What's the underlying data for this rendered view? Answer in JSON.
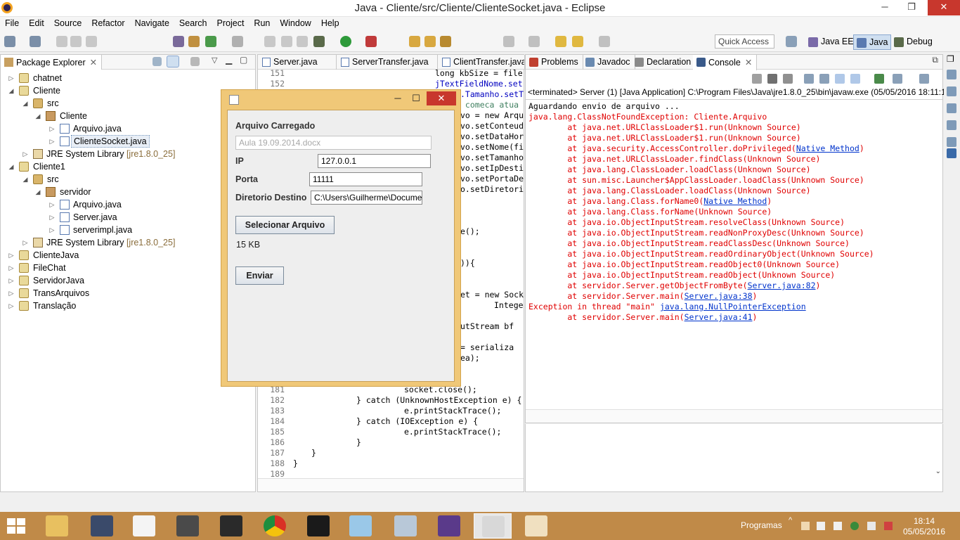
{
  "window": {
    "title": "Java - Cliente/src/Cliente/ClienteSocket.java - Eclipse"
  },
  "menu": [
    "File",
    "Edit",
    "Source",
    "Refactor",
    "Navigate",
    "Search",
    "Project",
    "Run",
    "Window",
    "Help"
  ],
  "toolbar": {
    "quick_access": "Quick Access",
    "perspectives": [
      "Java EE",
      "Java",
      "Debug"
    ]
  },
  "package_explorer": {
    "title": "Package Explorer",
    "rows": [
      {
        "label": "chatnet",
        "version": ""
      },
      {
        "label": "Cliente",
        "version": ""
      },
      {
        "label": "src",
        "version": ""
      },
      {
        "label": "Cliente",
        "version": ""
      },
      {
        "label": "Arquivo.java",
        "version": ""
      },
      {
        "label": "ClienteSocket.java",
        "version": ""
      },
      {
        "label": "JRE System Library",
        "version": "[jre1.8.0_25]"
      },
      {
        "label": "Cliente1",
        "version": ""
      },
      {
        "label": "src",
        "version": ""
      },
      {
        "label": "servidor",
        "version": ""
      },
      {
        "label": "Arquivo.java",
        "version": ""
      },
      {
        "label": "Server.java",
        "version": ""
      },
      {
        "label": "serverimpl.java",
        "version": ""
      },
      {
        "label": "JRE System Library",
        "version": "[jre1.8.0_25]"
      },
      {
        "label": "ClienteJava",
        "version": ""
      },
      {
        "label": "FileChat",
        "version": ""
      },
      {
        "label": "ServidorJava",
        "version": ""
      },
      {
        "label": "TransArquivos",
        "version": ""
      },
      {
        "label": "Translação",
        "version": ""
      }
    ]
  },
  "editor": {
    "tabs": [
      "Server.java",
      "ServerTransfer.java",
      "ClientTransfer.java"
    ],
    "lines": [
      {
        "n": "151",
        "text": "long kbSize = file"
      },
      {
        "n": "152",
        "text": "jTextFieldNome.set"
      },
      {
        "n": "",
        "text": ".Tamanho.setT"
      },
      {
        "n": "",
        "text": " comeca atua"
      },
      {
        "n": "",
        "text": "vo = new Arqu"
      },
      {
        "n": "",
        "text": "vo.setConteud"
      },
      {
        "n": "",
        "text": "vo.setDataHor"
      },
      {
        "n": "",
        "text": "vo.setNome(fi"
      },
      {
        "n": "",
        "text": "vo.setTamanho"
      },
      {
        "n": "",
        "text": "vo.setIpDesti"
      },
      {
        "n": "",
        "text": "vo.setPortaDe"
      },
      {
        "n": "",
        "text": "o.setDiretori"
      },
      {
        "n": "",
        "text": "e();"
      },
      {
        "n": "",
        "text": ")){"
      },
      {
        "n": "",
        "text": "et = new Sock"
      },
      {
        "n": "",
        "text": "Intege"
      },
      {
        "n": "",
        "text": "utStream bf"
      },
      {
        "n": "",
        "text": "= serializa"
      },
      {
        "n": "",
        "text": "ea);"
      },
      {
        "n": "181",
        "text": "socket.close();"
      },
      {
        "n": "182",
        "text": "} catch (UnknownHostException e) {"
      },
      {
        "n": "183",
        "text": "e.printStackTrace();"
      },
      {
        "n": "184",
        "text": "} catch (IOException e) {"
      },
      {
        "n": "185",
        "text": "e.printStackTrace();"
      },
      {
        "n": "186",
        "text": "}"
      },
      {
        "n": "187",
        "text": "}"
      },
      {
        "n": "188",
        "text": "}"
      },
      {
        "n": "189",
        "text": ""
      }
    ]
  },
  "console": {
    "tabs": [
      "Problems",
      "Javadoc",
      "Declaration",
      "Console"
    ],
    "terminated": "<terminated> Server (1) [Java Application] C:\\Program Files\\Java\\jre1.8.0_25\\bin\\javaw.exe (05/05/2016 18:11:16)",
    "lines": [
      {
        "pre": "Aguardando envio de arquivo ...",
        "link": "",
        "post": "",
        "style": "blk"
      },
      {
        "pre": "java.lang.ClassNotFoundException: Cliente.Arquivo",
        "link": "",
        "post": "",
        "style": "err"
      },
      {
        "pre": "\tat java.net.URLClassLoader$1.run(Unknown Source)",
        "link": "",
        "post": "",
        "style": "err"
      },
      {
        "pre": "\tat java.net.URLClassLoader$1.run(Unknown Source)",
        "link": "",
        "post": "",
        "style": "err"
      },
      {
        "pre": "\tat java.security.AccessController.doPrivileged(",
        "link": "Native Method",
        "post": ")",
        "style": "err"
      },
      {
        "pre": "\tat java.net.URLClassLoader.findClass(Unknown Source)",
        "link": "",
        "post": "",
        "style": "err"
      },
      {
        "pre": "\tat java.lang.ClassLoader.loadClass(Unknown Source)",
        "link": "",
        "post": "",
        "style": "err"
      },
      {
        "pre": "\tat sun.misc.Launcher$AppClassLoader.loadClass(Unknown Source)",
        "link": "",
        "post": "",
        "style": "err"
      },
      {
        "pre": "\tat java.lang.ClassLoader.loadClass(Unknown Source)",
        "link": "",
        "post": "",
        "style": "err"
      },
      {
        "pre": "\tat java.lang.Class.forName0(",
        "link": "Native Method",
        "post": ")",
        "style": "err"
      },
      {
        "pre": "\tat java.lang.Class.forName(Unknown Source)",
        "link": "",
        "post": "",
        "style": "err"
      },
      {
        "pre": "\tat java.io.ObjectInputStream.resolveClass(Unknown Source)",
        "link": "",
        "post": "",
        "style": "err"
      },
      {
        "pre": "\tat java.io.ObjectInputStream.readNonProxyDesc(Unknown Source)",
        "link": "",
        "post": "",
        "style": "err"
      },
      {
        "pre": "\tat java.io.ObjectInputStream.readClassDesc(Unknown Source)",
        "link": "",
        "post": "",
        "style": "err"
      },
      {
        "pre": "\tat java.io.ObjectInputStream.readOrdinaryObject(Unknown Source)",
        "link": "",
        "post": "",
        "style": "err"
      },
      {
        "pre": "\tat java.io.ObjectInputStream.readObject0(Unknown Source)",
        "link": "",
        "post": "",
        "style": "err"
      },
      {
        "pre": "\tat java.io.ObjectInputStream.readObject(Unknown Source)",
        "link": "",
        "post": "",
        "style": "err"
      },
      {
        "pre": "\tat servidor.Server.getObjectFromByte(",
        "link": "Server.java:82",
        "post": ")",
        "style": "err"
      },
      {
        "pre": "\tat servidor.Server.main(",
        "link": "Server.java:38",
        "post": ")",
        "style": "err"
      },
      {
        "pre": "Exception in thread \"main\" ",
        "link": "java.lang.NullPointerException",
        "post": "",
        "style": "err"
      },
      {
        "pre": "\tat servidor.Server.main(",
        "link": "Server.java:41",
        "post": ")",
        "style": "err"
      }
    ]
  },
  "dialog": {
    "arquivo_label": "Arquivo Carregado",
    "arquivo_value": "Aula 19.09.2014.docx",
    "ip_label": "IP",
    "ip_value": "127.0.0.1",
    "porta_label": "Porta",
    "porta_value": "11111",
    "diretorio_label": "Diretorio Destino",
    "diretorio_value": "C:\\Users\\Guilherme\\Documents",
    "select_button": "Selecionar Arquivo",
    "size_text": "15 KB",
    "send_button": "Enviar"
  },
  "taskbar": {
    "tray_label": "Programas",
    "time": "18:14",
    "date": "05/05/2016",
    "apps": [
      "file-explorer-icon",
      "computer-icon",
      "app-icon",
      "sublime-icon",
      "mysql-icon",
      "chrome-icon",
      "cmd-icon",
      "notes-icon",
      "monitor-icon",
      "java-ee-ide-icon",
      "java-icon",
      "paint-icon"
    ]
  },
  "colors": {
    "taskbar": "#c08a48",
    "dialog_frame": "#f0c878",
    "close_red": "#c8372d",
    "error_red": "#e00000",
    "link_blue": "#0033cc"
  }
}
